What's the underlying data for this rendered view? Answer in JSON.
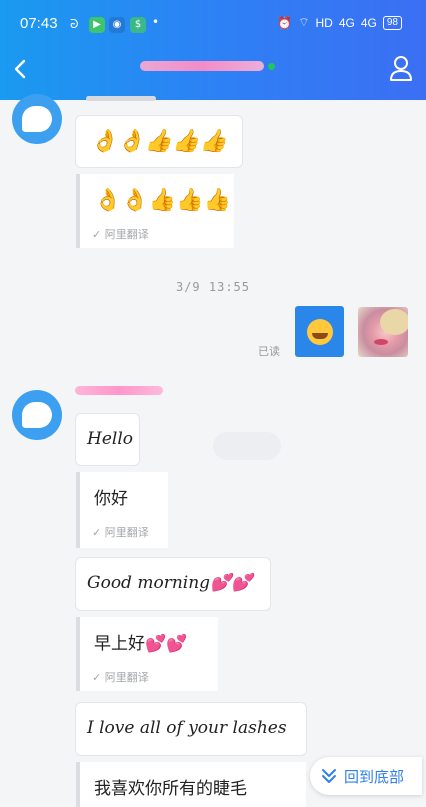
{
  "status_bar": {
    "time": "07:43",
    "network_label": "HD",
    "signal_1": "4G",
    "signal_2": "4G",
    "battery": "98",
    "icons": [
      "whatsapp-style-icon",
      "app-icon",
      "app-icon-2",
      "alarm-icon",
      "wifi-icon",
      "signal-icon",
      "battery-icon"
    ]
  },
  "header": {
    "back_icon": "chevron-left-icon",
    "contact_name_redacted": true,
    "online": true,
    "profile_icon": "person-icon",
    "colors": {
      "gradient_start": "#1a9af0",
      "gradient_end": "#3b6ff3"
    }
  },
  "messages": {
    "first_group": {
      "emoji_original": "👌👌👍👍👍",
      "emoji_translated": "👌👌👍👍👍",
      "translation_label": "✓ 阿里翻译"
    },
    "timestamp": "3/9 13:55",
    "sent": {
      "read_label": "已读",
      "sticker": "blushing-emoji-sticker"
    },
    "second_group": {
      "hello": "Hello",
      "hello_translation": "你好",
      "good_morning": "Good morning💕💕",
      "good_morning_translation": "早上好💕💕",
      "lashes": "I love all of your lashes",
      "lashes_translation": "我喜欢你所有的睫毛",
      "translation_label": "✓ 阿里翻译"
    }
  },
  "jump_to_bottom": {
    "label": "回到底部",
    "icon": "double-chevron-down-icon"
  }
}
